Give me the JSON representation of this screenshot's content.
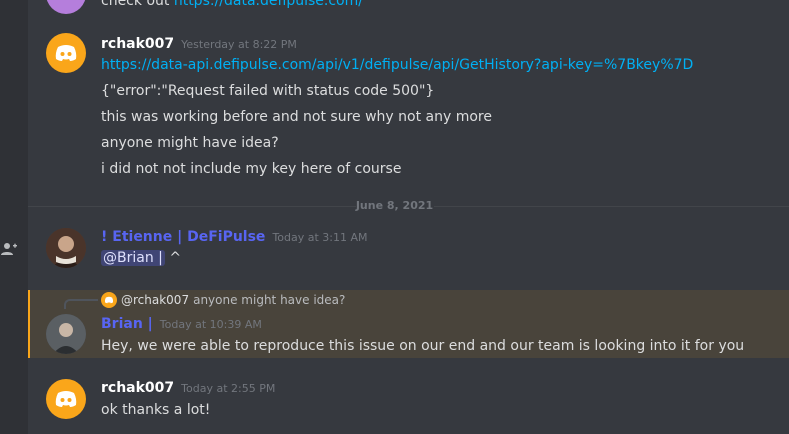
{
  "top_partial": {
    "text": "check out ",
    "link": "https://data.defipulse.com/"
  },
  "messages": [
    {
      "author": "rchak007",
      "timestamp": "Yesterday at 8:22 PM",
      "link": "https://data-api.defipulse.com/api/v1/defipulse/api/GetHistory?api-key=%7Bkey%7D",
      "lines": [
        "{\"error\":\"Request failed with status code 500\"}",
        "this was working before and not sure why  not any more",
        "anyone might have idea?",
        "i did not not include my key here of course"
      ]
    },
    {
      "author": "! Etienne | DeFiPulse",
      "author_color": "#5865f2",
      "timestamp": "Today at 3:11 AM",
      "mention": "@Brian |",
      "text": " ^"
    },
    {
      "reply_to_user": "@rchak007",
      "reply_to_text": "anyone might have idea?",
      "author": "Brian |",
      "author_color": "#5865f2",
      "timestamp": "Today at 10:39 AM",
      "text": "Hey, we were able to reproduce this issue on our end and our team is looking into it for you"
    },
    {
      "author": "rchak007",
      "timestamp": "Today at 2:55 PM",
      "text": "ok thanks a lot!"
    }
  ],
  "date_divider": "June 8, 2021",
  "icons": {
    "left_rail": "add-friend-icon",
    "discord_avatar": "discord-logo-icon"
  },
  "colors": {
    "background": "#36393f",
    "link": "#00b0f4",
    "highlight": "#faa61a"
  }
}
